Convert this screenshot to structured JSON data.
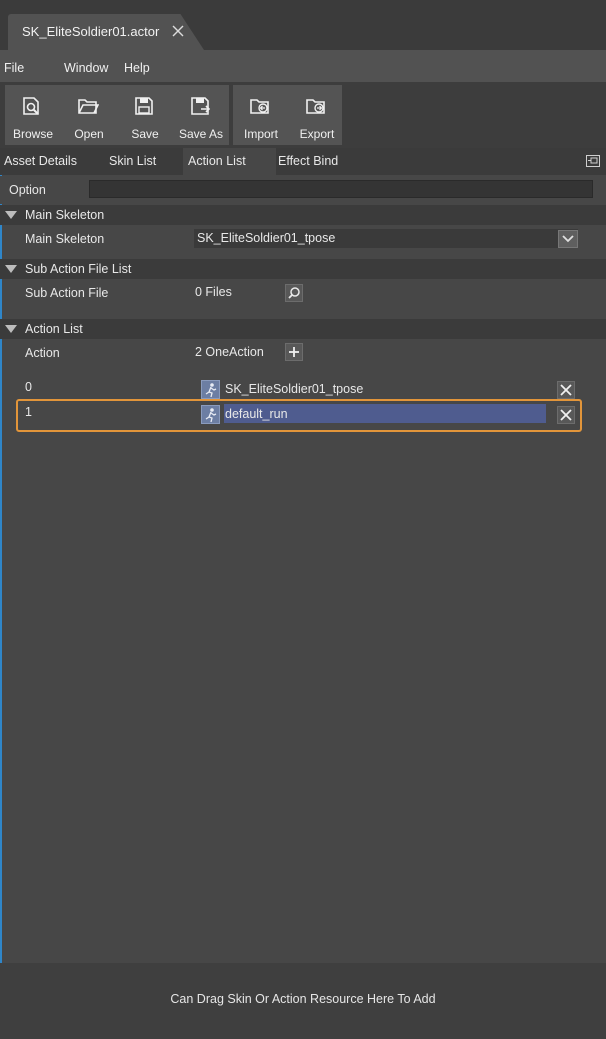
{
  "document_tab": {
    "title": "SK_EliteSoldier01.actor"
  },
  "menu": {
    "items": [
      "File",
      "Window",
      "Help"
    ]
  },
  "toolbar": {
    "browse": "Browse",
    "open": "Open",
    "save": "Save",
    "save_as": "Save As",
    "import": "Import",
    "export": "Export"
  },
  "tabs": [
    "Asset Details",
    "Skin List",
    "Action List",
    "Effect Bind"
  ],
  "active_tab": "Action List",
  "option": {
    "label": "Option",
    "value": ""
  },
  "main_skeleton": {
    "header": "Main Skeleton",
    "label": "Main Skeleton",
    "selected": "SK_EliteSoldier01_tpose"
  },
  "sub_action": {
    "header": "Sub Action File List",
    "label": "Sub Action File",
    "value": "0 Files"
  },
  "action_list": {
    "header": "Action List",
    "label": "Action",
    "count": "2 OneAction",
    "rows": [
      {
        "index": "0",
        "name": "SK_EliteSoldier01_tpose"
      },
      {
        "index": "1",
        "name": "default_run"
      }
    ]
  },
  "footer": {
    "hint": "Can Drag Skin Or Action Resource Here To Add"
  },
  "colors": {
    "highlight": "#e2953a",
    "selection": "#4f5c8f",
    "window_edge": "#2f86c9"
  }
}
